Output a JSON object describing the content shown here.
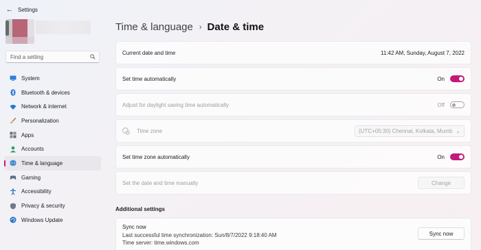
{
  "app": {
    "title": "Settings",
    "back_icon": "back-arrow-icon"
  },
  "search": {
    "placeholder": "Find a setting",
    "icon": "search-icon"
  },
  "sidebar": {
    "items": [
      {
        "label": "System",
        "icon": "system-icon",
        "active": false
      },
      {
        "label": "Bluetooth & devices",
        "icon": "bluetooth-icon",
        "active": false
      },
      {
        "label": "Network & internet",
        "icon": "wifi-icon",
        "active": false
      },
      {
        "label": "Personalization",
        "icon": "brush-icon",
        "active": false
      },
      {
        "label": "Apps",
        "icon": "apps-icon",
        "active": false
      },
      {
        "label": "Accounts",
        "icon": "person-icon",
        "active": false
      },
      {
        "label": "Time & language",
        "icon": "globe-clock-icon",
        "active": true
      },
      {
        "label": "Gaming",
        "icon": "gamepad-icon",
        "active": false
      },
      {
        "label": "Accessibility",
        "icon": "accessibility-icon",
        "active": false
      },
      {
        "label": "Privacy & security",
        "icon": "shield-icon",
        "active": false
      },
      {
        "label": "Windows Update",
        "icon": "update-icon",
        "active": false
      }
    ]
  },
  "breadcrumb": {
    "parent": "Time & language",
    "separator": "›",
    "current": "Date & time"
  },
  "settings": {
    "current_date_label": "Current date and time",
    "current_date_value": "11:42 AM, Sunday, August 7, 2022",
    "set_time_auto_label": "Set time automatically",
    "set_time_auto_state": "On",
    "dst_label": "Adjust for daylight saving time automatically",
    "dst_state": "Off",
    "timezone_label": "Time zone",
    "timezone_value": "(UTC+05:30) Chennai, Kolkata, Mumb",
    "set_tz_auto_label": "Set time zone automatically",
    "set_tz_auto_state": "On",
    "manual_label": "Set the date and time manually",
    "change_label": "Change"
  },
  "additional": {
    "title": "Additional settings",
    "sync_title": "Sync now",
    "sync_last": "Last successful time synchronization: Sun/8/7/2022 9:18:40 AM",
    "sync_server": "Time server: time.windows.com",
    "sync_button": "Sync now"
  },
  "colors": {
    "accent": "#c3197b"
  }
}
